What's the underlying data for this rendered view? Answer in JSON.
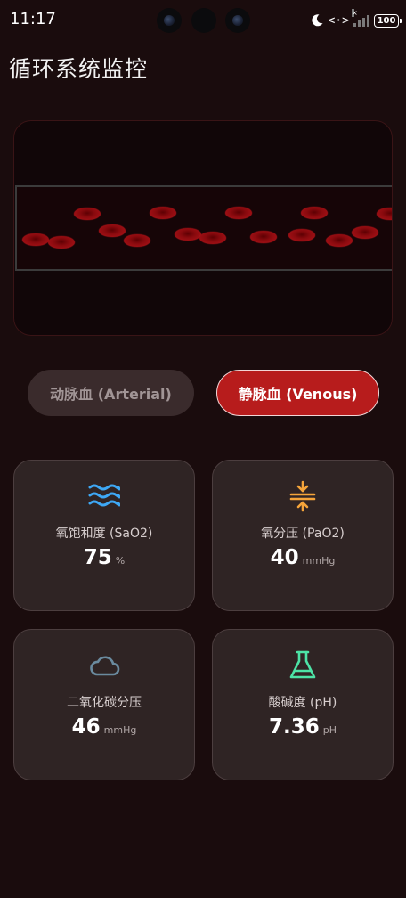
{
  "status_bar": {
    "time": "11:17",
    "battery": "100",
    "network_icons": "<·>",
    "signal_flag": "×"
  },
  "page": {
    "title": "循环系统监控"
  },
  "vessel": {
    "cell_color": "#b0141a",
    "tube_color": "#3b3b3b"
  },
  "modes": {
    "arterial_label": "动脉血 (Arterial)",
    "venous_label": "静脉血 (Venous)",
    "selected": "venous",
    "selected_color": "#b71c1c"
  },
  "metrics": [
    {
      "icon": "waves-icon",
      "icon_color": "#3ea8f5",
      "label": "氧饱和度 (SaO2)",
      "value": "75",
      "unit": "%"
    },
    {
      "icon": "compress-icon",
      "icon_color": "#f5a43a",
      "label": "氧分压 (PaO2)",
      "value": "40",
      "unit": "mmHg"
    },
    {
      "icon": "cloud-icon",
      "icon_color": "#6a8a9e",
      "label": "二氧化碳分压",
      "value": "46",
      "unit": "mmHg"
    },
    {
      "icon": "flask-icon",
      "icon_color": "#4de3a6",
      "label": "酸碱度 (pH)",
      "value": "7.36",
      "unit": "pH"
    }
  ]
}
